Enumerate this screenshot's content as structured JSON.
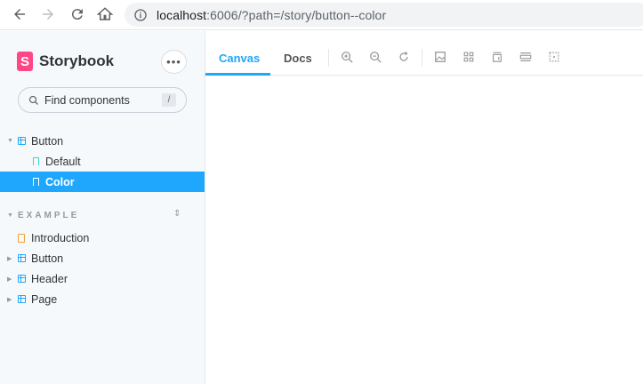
{
  "browser": {
    "url_host": "localhost",
    "url_rest": ":6006/?path=/story/button--color"
  },
  "sidebar": {
    "brand": "Storybook",
    "brand_logo_letter": "S",
    "menu_label": "•••",
    "search": {
      "placeholder": "Find components",
      "shortcut": "/"
    },
    "tree": [
      {
        "label": "Button",
        "type": "component",
        "expanded": true
      },
      {
        "label": "Default",
        "type": "story"
      },
      {
        "label": "Color",
        "type": "story",
        "selected": true
      }
    ],
    "section": {
      "title": "EXAMPLE",
      "toggle": "⌃⌄"
    },
    "example_items": [
      {
        "label": "Introduction",
        "type": "doc"
      },
      {
        "label": "Button",
        "type": "component"
      },
      {
        "label": "Header",
        "type": "component"
      },
      {
        "label": "Page",
        "type": "component"
      }
    ]
  },
  "toolbar": {
    "tabs": [
      {
        "label": "Canvas",
        "active": true
      },
      {
        "label": "Docs",
        "active": false
      }
    ],
    "tools": [
      "zoom-in-icon",
      "zoom-out-icon",
      "zoom-reset-icon",
      "background-icon",
      "grid-icon",
      "viewport-icon",
      "measure-icon",
      "outline-icon"
    ]
  },
  "colors": {
    "accent": "#1ea7fd",
    "brand": "#ff4785",
    "sidebar_bg": "#f6f9fc"
  }
}
